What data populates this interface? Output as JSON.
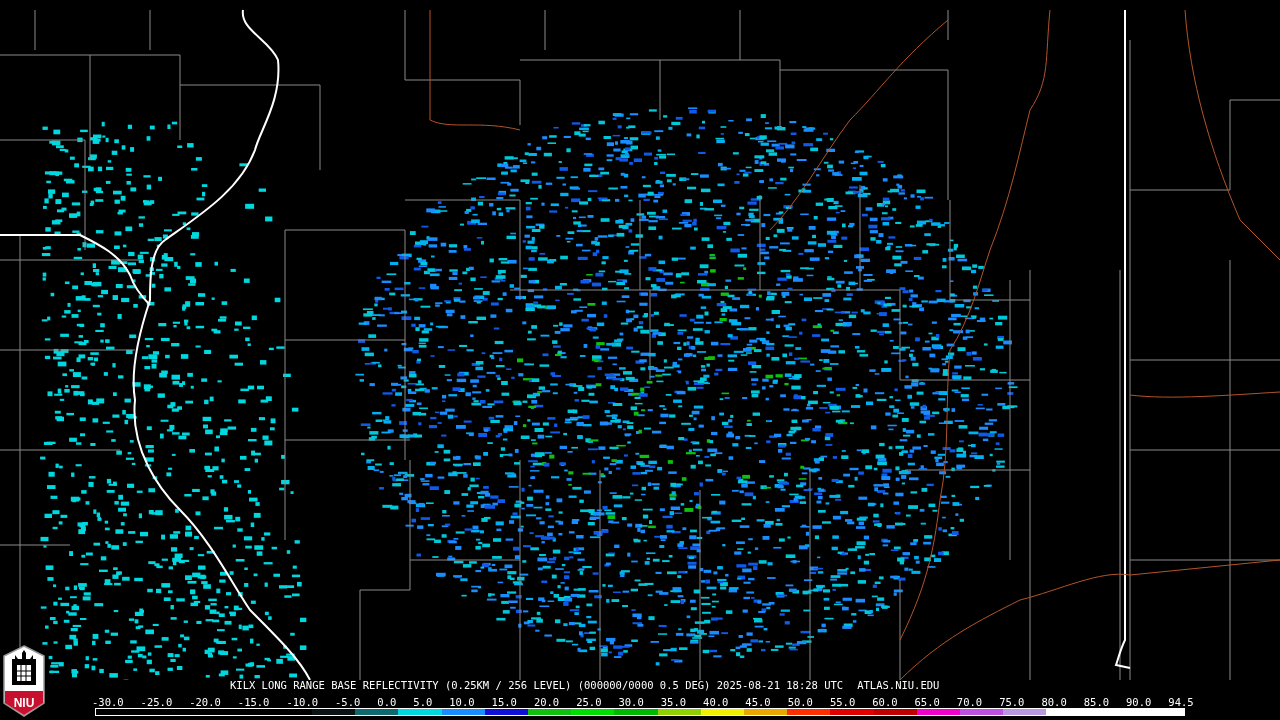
{
  "logo": {
    "text": "NIU"
  },
  "title": "KILX LONG RANGE BASE REFLECTIVITY (0.25KM / 256 LEVEL) (000000/0000 0.5 DEG) 2025-08-21 18:28 UTC",
  "source": "ATLAS.NIU.EDU",
  "color_scale": [
    {
      "label": "-30.0"
    },
    {
      "label": "-25.0"
    },
    {
      "label": "-20.0"
    },
    {
      "label": "-15.0"
    },
    {
      "label": "-10.0"
    },
    {
      "label": "-5.0",
      "color": "#0a1414"
    },
    {
      "label": "0.0",
      "color": "#0e6a6e"
    },
    {
      "label": "5.0",
      "color": "#00d8e0"
    },
    {
      "label": "10.0",
      "color": "#1a8cff"
    },
    {
      "label": "15.0",
      "color": "#1010d8"
    },
    {
      "label": "20.0",
      "color": "#10c010"
    },
    {
      "label": "25.0",
      "color": "#00e000"
    },
    {
      "label": "30.0",
      "color": "#00b800"
    },
    {
      "label": "35.0",
      "color": "#90d000"
    },
    {
      "label": "40.0",
      "color": "#f0f000"
    },
    {
      "label": "45.0",
      "color": "#e8a800"
    },
    {
      "label": "50.0",
      "color": "#ff3000"
    },
    {
      "label": "55.0",
      "color": "#e00000"
    },
    {
      "label": "60.0",
      "color": "#c00000"
    },
    {
      "label": "65.0",
      "color": "#f000c8"
    },
    {
      "label": "70.0",
      "color": "#c050e0"
    },
    {
      "label": "75.0",
      "color": "#b898e0"
    },
    {
      "label": "80.0",
      "color": "#ffffff"
    },
    {
      "label": "85.0",
      "color": "#ffffff"
    },
    {
      "label": "90.0",
      "color": "#ffffff"
    },
    {
      "label": "94.5",
      "color": "#ffffff"
    }
  ]
}
